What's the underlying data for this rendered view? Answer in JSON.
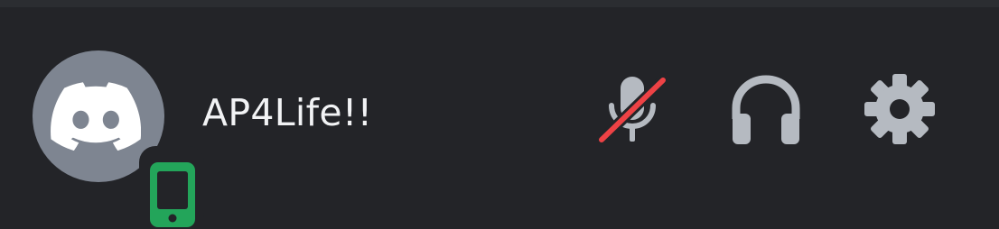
{
  "user": {
    "username": "AP4Life!!",
    "avatar_icon": "discord-logo-icon",
    "status_icon": "mobile-phone-icon",
    "status_color": "#23a55a"
  },
  "controls": {
    "mute": {
      "icon": "microphone-muted-icon",
      "muted": true,
      "strike_color": "#ed4245"
    },
    "deafen": {
      "icon": "headphones-icon"
    },
    "settings": {
      "icon": "gear-icon"
    }
  },
  "colors": {
    "background": "#232428",
    "avatar_bg": "#7e8591",
    "icon_color": "#b5bac1",
    "username_color": "#f2f3f5"
  }
}
